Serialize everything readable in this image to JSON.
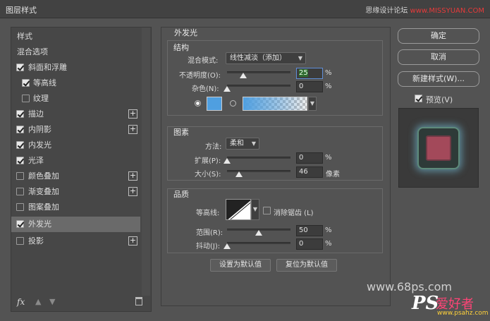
{
  "window": {
    "title": "图层样式",
    "watermark_prefix": "思缘设计论坛",
    "watermark_site": "www.MISSYUAN.COM"
  },
  "left_list": {
    "items": [
      {
        "label": "样式",
        "checkbox": null,
        "plus": false,
        "selected": false
      },
      {
        "label": "混合选项",
        "checkbox": null,
        "plus": false,
        "selected": false
      },
      {
        "label": "斜面和浮雕",
        "checkbox": true,
        "plus": false,
        "selected": false
      },
      {
        "label": "等高线",
        "checkbox": true,
        "plus": false,
        "selected": false,
        "indent": true
      },
      {
        "label": "纹理",
        "checkbox": false,
        "plus": false,
        "selected": false,
        "indent": true
      },
      {
        "label": "描边",
        "checkbox": true,
        "plus": true,
        "selected": false
      },
      {
        "label": "内阴影",
        "checkbox": true,
        "plus": true,
        "selected": false
      },
      {
        "label": "内发光",
        "checkbox": true,
        "plus": false,
        "selected": false
      },
      {
        "label": "光泽",
        "checkbox": true,
        "plus": false,
        "selected": false
      },
      {
        "label": "颜色叠加",
        "checkbox": false,
        "plus": true,
        "selected": false
      },
      {
        "label": "渐变叠加",
        "checkbox": false,
        "plus": true,
        "selected": false
      },
      {
        "label": "图案叠加",
        "checkbox": false,
        "plus": false,
        "selected": false
      },
      {
        "label": "外发光",
        "checkbox": true,
        "plus": false,
        "selected": true
      },
      {
        "label": "投影",
        "checkbox": false,
        "plus": true,
        "selected": false
      }
    ],
    "footer": {
      "fx_label": "fx",
      "up_icon": "▲",
      "down_icon": "▼"
    }
  },
  "outer_glow": {
    "section_title": "外发光",
    "structure": {
      "title": "结构",
      "blend_mode_label": "混合模式:",
      "blend_mode_value": "线性减淡（添加）",
      "opacity_label": "不透明度(O):",
      "opacity_value": "25",
      "opacity_fraction": 0.25,
      "noise_label": "杂色(N):",
      "noise_value": "0",
      "noise_fraction": 0,
      "unit": "%",
      "color_swatch": "#4f9fe0"
    },
    "elements": {
      "title": "图素",
      "technique_label": "方法:",
      "technique_value": "柔和",
      "spread_label": "扩展(P):",
      "spread_value": "0",
      "spread_fraction": 0,
      "size_label": "大小(S):",
      "size_value": "46",
      "size_unit": "像素",
      "size_fraction": 0.184,
      "unit": "%"
    },
    "quality": {
      "title": "品质",
      "contour_label": "等高线:",
      "antialias_label": "消除锯齿 (L)",
      "range_label": "范围(R):",
      "range_value": "50",
      "range_fraction": 0.5,
      "jitter_label": "抖动(J):",
      "jitter_value": "0",
      "jitter_fraction": 0,
      "unit": "%"
    },
    "buttons": {
      "make_default": "设置为默认值",
      "reset_default": "复位为默认值"
    }
  },
  "right": {
    "ok": "确定",
    "cancel": "取消",
    "new_style": "新建样式(W)...",
    "preview_label": "预览(V)"
  },
  "watermarks": {
    "bottom": "www.68ps.com",
    "corner_ps": "PS",
    "corner_cn": "爱好者",
    "corner_url": "www.psahz.com"
  }
}
